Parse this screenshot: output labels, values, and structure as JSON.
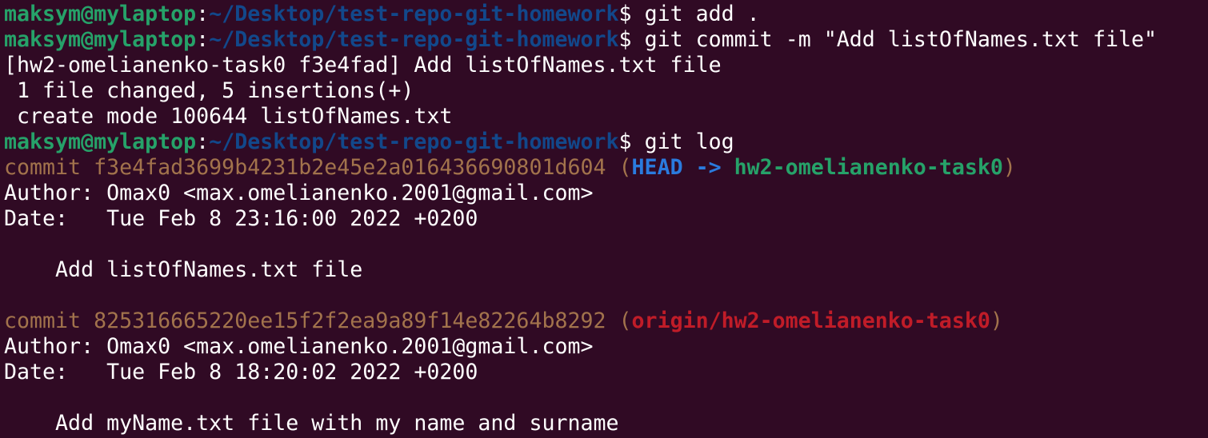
{
  "prompt": {
    "user_host": "maksym@mylaptop",
    "colon": ":",
    "path": "~/Desktop/test-repo-git-homework",
    "dollar": "$ "
  },
  "commands": [
    "git add .",
    "git commit -m \"Add listOfNames.txt file\"",
    "git log"
  ],
  "commit_output": [
    "[hw2-omelianenko-task0 f3e4fad] Add listOfNames.txt file",
    " 1 file changed, 5 insertions(+)",
    " create mode 100644 listOfNames.txt"
  ],
  "log": [
    {
      "commit_prefix": "commit f3e4fad3699b4231b2e45e2a016436690801d604 ",
      "paren_open": "(",
      "head": "HEAD -> ",
      "branch": "hw2-omelianenko-task0",
      "paren_close": ")",
      "author": "Author: Omax0 <max.omelianenko.2001@gmail.com>",
      "date": "Date:   Tue Feb 8 23:16:00 2022 +0200",
      "message": "    Add listOfNames.txt file"
    },
    {
      "commit_prefix": "commit 825316665220ee15f2f2ea9a89f14e82264b8292 ",
      "paren_open": "(",
      "branch": "origin/hw2-omelianenko-task0",
      "paren_close": ")",
      "author": "Author: Omax0 <max.omelianenko.2001@gmail.com>",
      "date": "Date:   Tue Feb 8 18:20:02 2022 +0200",
      "message": "    Add myName.txt file with my name and surname"
    }
  ],
  "colors": {
    "background": "#300a24",
    "text": "#ffffff",
    "user_host": "#26a269",
    "path": "#12488b",
    "commit_hash": "#a2734c",
    "head": "#2a7bde",
    "remote_branch": "#c01c28"
  }
}
